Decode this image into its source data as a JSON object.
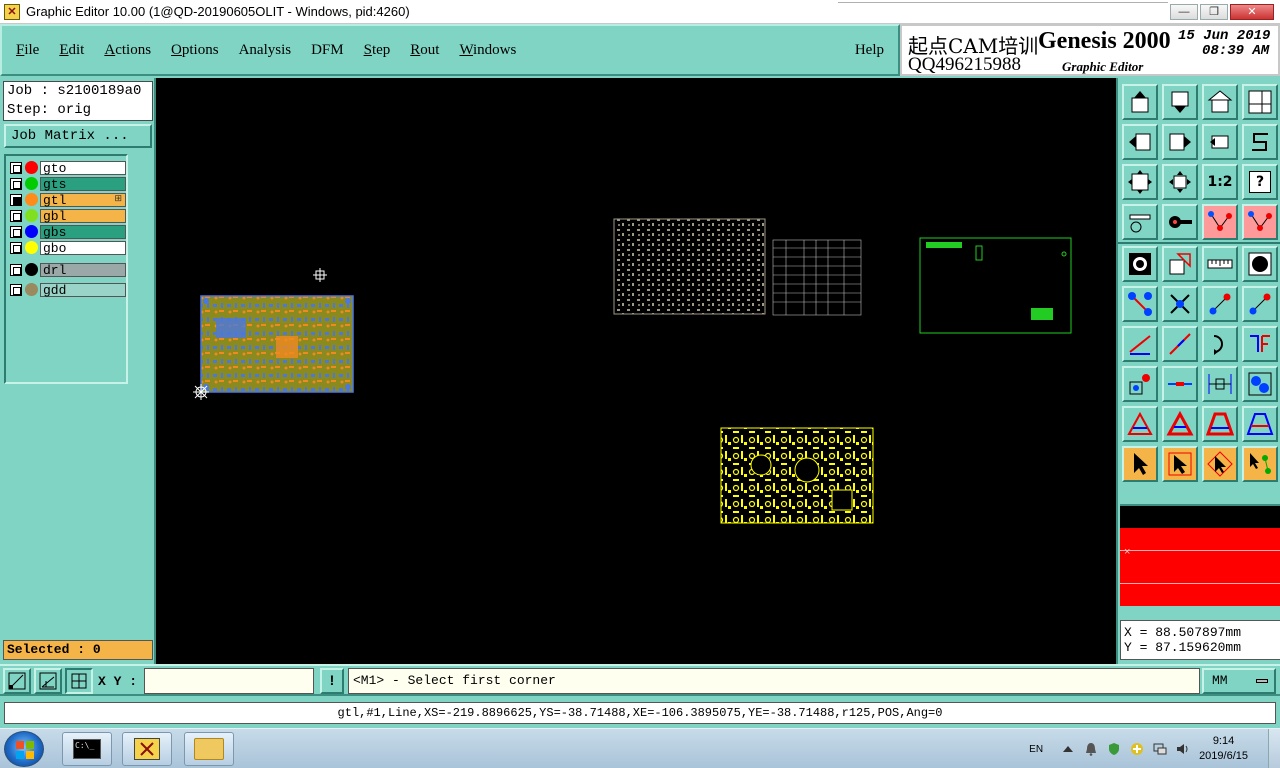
{
  "window": {
    "title": "Graphic Editor 10.00 (1@QD-20190605OLIT - Windows, pid:4260)",
    "controls": {
      "minimize": "—",
      "maximize": "❐",
      "close": "✕"
    }
  },
  "menu": {
    "items": [
      {
        "label": "File",
        "u": "F",
        "rest": "ile"
      },
      {
        "label": "Edit",
        "u": "E",
        "rest": "dit"
      },
      {
        "label": "Actions",
        "u": "A",
        "rest": "ctions"
      },
      {
        "label": "Options",
        "u": "O",
        "rest": "ptions"
      },
      {
        "label": "Analysis",
        "u": "",
        "rest": "Analysis"
      },
      {
        "label": "DFM",
        "u": "",
        "rest": "DFM"
      },
      {
        "label": "Step",
        "u": "S",
        "rest": "tep"
      },
      {
        "label": "Rout",
        "u": "R",
        "rest": "out"
      },
      {
        "label": "Windows",
        "u": "W",
        "rest": "indows"
      }
    ],
    "help": "Help"
  },
  "brand": {
    "chinese": "起点CAM培训",
    "qq": "QQ496215988",
    "product": "Genesis 2000",
    "subtitle": "Graphic Editor",
    "date": "15 Jun 2019",
    "time": "08:39 AM"
  },
  "job": {
    "job_label": "Job : s2100189a0",
    "step_label": "Step: orig",
    "matrix_button": "Job Matrix ..."
  },
  "layers": [
    {
      "name": "gto",
      "dot": "#ff0000",
      "bg": "#ffffff",
      "checked": false
    },
    {
      "name": "gts",
      "dot": "#00cc00",
      "bg": "#2aa080",
      "checked": false
    },
    {
      "name": "gtl",
      "dot": "#ff8c1a",
      "bg": "#f5b448",
      "checked": true,
      "flag": "⊞"
    },
    {
      "name": "gbl",
      "dot": "#80e020",
      "bg": "#f5b448",
      "checked": false
    },
    {
      "name": "gbs",
      "dot": "#0000ff",
      "bg": "#2aa080",
      "checked": false
    },
    {
      "name": "gbo",
      "dot": "#ffff00",
      "bg": "#ffffff",
      "checked": false
    },
    {
      "name": "drl",
      "dot": "#000000",
      "bg": "#9aa8a8",
      "checked": false
    },
    {
      "name": "gdd",
      "dot": "#9a8a60",
      "bg": "#9ad4c8",
      "checked": false
    }
  ],
  "selected_label": "Selected : 0",
  "toolbar_icons": [
    "move-up-icon",
    "move-down-icon",
    "home-icon",
    "window-split-icon",
    "move-left-icon",
    "move-right-icon",
    "swap-icon",
    "s-curve-icon",
    "fit-screen-icon",
    "zoom-center-icon",
    "ratio-icon",
    "help-icon",
    "tool-config-icon",
    "probe-icon",
    "net-red-icon",
    "net-red-alt-icon",
    "pad-icon",
    "cut-shape-icon",
    "ruler-icon",
    "circle-select-icon",
    "connect-nodes-icon",
    "delete-x-icon",
    "line-nodes-icon",
    "line-nodes-alt-icon",
    "draw-line-icon",
    "slash-line-icon",
    "arc-icon",
    "trace-icon",
    "add-pad-icon",
    "split-line-icon",
    "measure-icon",
    "blob-icon",
    "triangle-a-icon",
    "triangle-a-bold-icon",
    "trapezoid-icon",
    "trapezoid-alt-icon",
    "select-arrow-icon",
    "select-arrow-box-icon",
    "select-arrow-diamond-icon",
    "select-net-icon"
  ],
  "ratio_label": "1:2",
  "help_label": "?",
  "coords": {
    "x": "X = 88.507897mm",
    "y": "Y = 87.159620mm"
  },
  "colorbox_mark": "×",
  "bottom": {
    "xy_label": "X Y :",
    "xy_value": "",
    "bang": "!",
    "prompt": "<M1> - Select first corner",
    "unit": "MM",
    "status": "gtl,#1,Line,XS=-219.8896625,YS=-38.71488,XE=-106.3895075,YE=-38.71488,r125,POS,Ang=0"
  },
  "taskbar": {
    "lang": "EN",
    "time": "9:14",
    "date": "2019/6/15",
    "cmd_text": "C:\\_"
  }
}
